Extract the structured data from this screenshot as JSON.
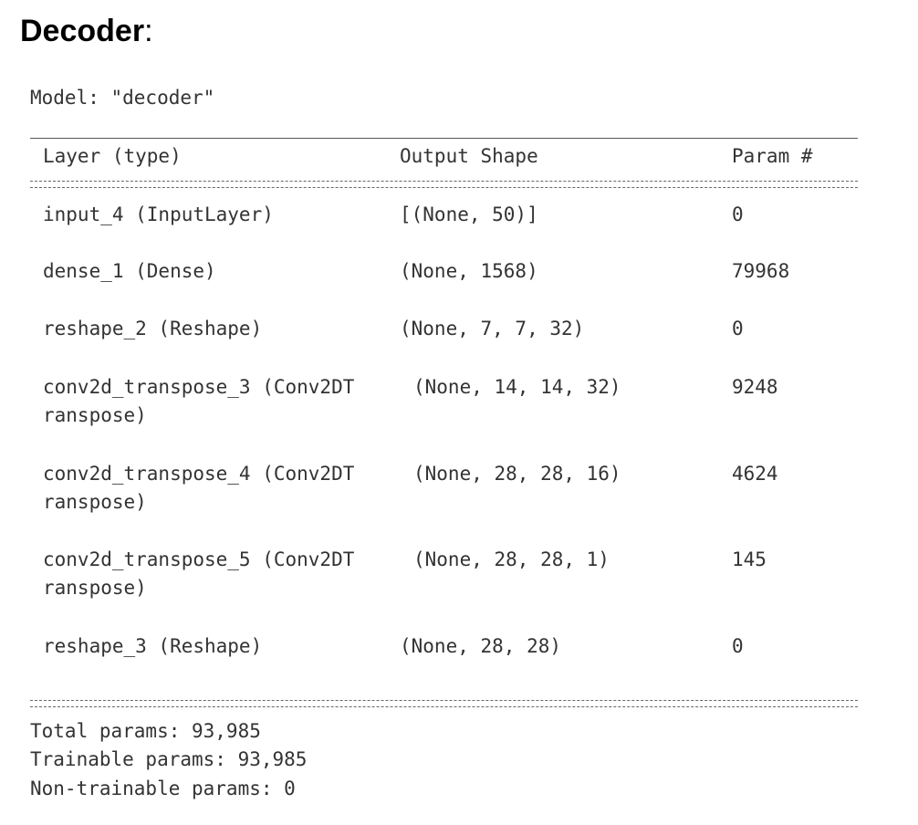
{
  "heading": {
    "title": "Decoder",
    "colon": ":"
  },
  "model_line": "Model: \"decoder\"",
  "table": {
    "headers": {
      "layer": "Layer (type)",
      "shape": "Output Shape",
      "params": "Param #"
    },
    "rows": [
      {
        "layer": "input_4 (InputLayer)",
        "layer_cont": "",
        "shape": "[(None, 50)]",
        "params": "0"
      },
      {
        "layer": "dense_1 (Dense)",
        "layer_cont": "",
        "shape": "(None, 1568)",
        "params": "79968"
      },
      {
        "layer": "reshape_2 (Reshape)",
        "layer_cont": "",
        "shape": "(None, 7, 7, 32)",
        "params": "0"
      },
      {
        "layer": "conv2d_transpose_3 (Conv2DT",
        "layer_cont": "ranspose)",
        "shape": "(None, 14, 14, 32)",
        "params": "9248"
      },
      {
        "layer": "conv2d_transpose_4 (Conv2DT",
        "layer_cont": "ranspose)",
        "shape": "(None, 28, 28, 16)",
        "params": "4624"
      },
      {
        "layer": "conv2d_transpose_5 (Conv2DT",
        "layer_cont": "ranspose)",
        "shape": "(None, 28, 28, 1)",
        "params": "145"
      },
      {
        "layer": "reshape_3 (Reshape)",
        "layer_cont": "",
        "shape": "(None, 28, 28)",
        "params": "0"
      }
    ]
  },
  "summary": {
    "total": "Total params: 93,985",
    "trainable": "Trainable params: 93,985",
    "non_trainable": "Non-trainable params: 0"
  }
}
